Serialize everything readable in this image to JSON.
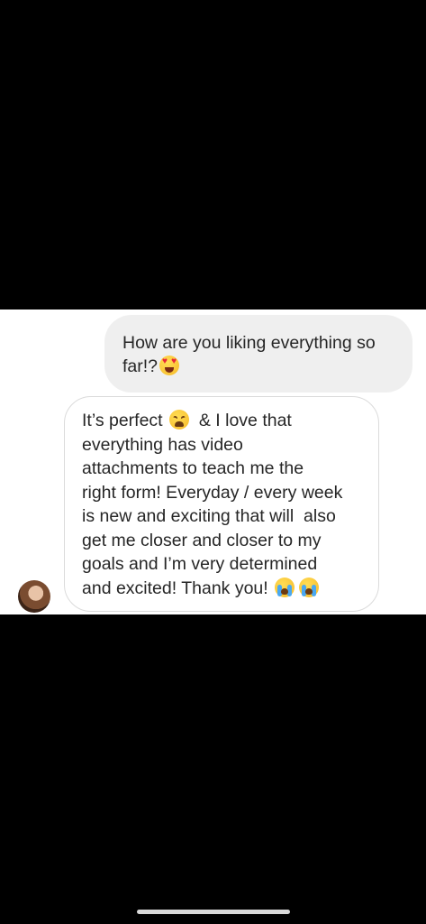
{
  "messages": {
    "sent": {
      "line1": "How are you liking everything so",
      "line2": "far!?",
      "emoji": "heart-eyes-emoji"
    },
    "received": {
      "line1": "It’s perfect",
      "line1_emoji": "weary-face-emoji",
      "line1_after": "& I love that",
      "line2": "everything has video",
      "line3": "attachments to teach me the",
      "line4": "right form! Everyday / every week",
      "line5": "is new and exciting that will  also",
      "line6": "get me closer and closer to my",
      "line7": "goals and I’m very determined",
      "line8": "and excited! Thank you!",
      "line8_emojis": [
        "crying-face-emoji",
        "crying-face-emoji"
      ]
    },
    "avatar": "contact-avatar"
  },
  "colors": {
    "background": "#000000",
    "chat_background": "#ffffff",
    "sent_bubble": "#efefef",
    "received_border": "#dbdbdb",
    "text": "#262626"
  }
}
